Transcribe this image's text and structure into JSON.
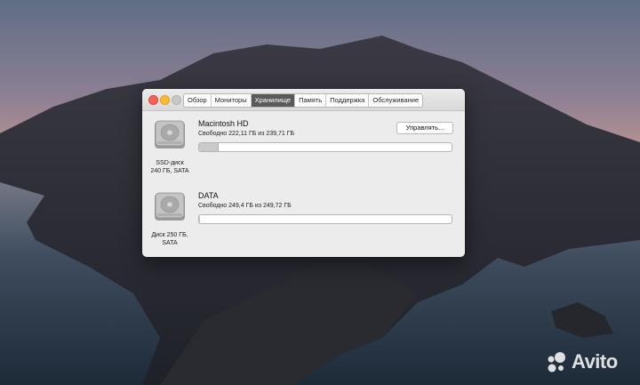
{
  "window": {
    "tabs": [
      {
        "label": "Обзор",
        "active": false
      },
      {
        "label": "Мониторы",
        "active": false
      },
      {
        "label": "Хранилище",
        "active": true
      },
      {
        "label": "Память",
        "active": false
      },
      {
        "label": "Поддержка",
        "active": false
      },
      {
        "label": "Обслуживание",
        "active": false
      }
    ]
  },
  "storage": {
    "manage_label": "Управлять...",
    "disks": [
      {
        "caption_line1": "SSD-диск",
        "caption_line2": "240 ГБ, SATA",
        "volume_name": "Macintosh HD",
        "free_text": "Свободно 222,11 ГБ из 239,71 ГБ",
        "used_fraction": 0.073
      },
      {
        "caption_line1": "Диск 250 ГБ,",
        "caption_line2": "SATA",
        "volume_name": "DATA",
        "free_text": "Свободно 249,4 ГБ из 249,72 ГБ",
        "used_fraction": 0.001
      }
    ]
  },
  "watermark": {
    "text": "Avito"
  }
}
